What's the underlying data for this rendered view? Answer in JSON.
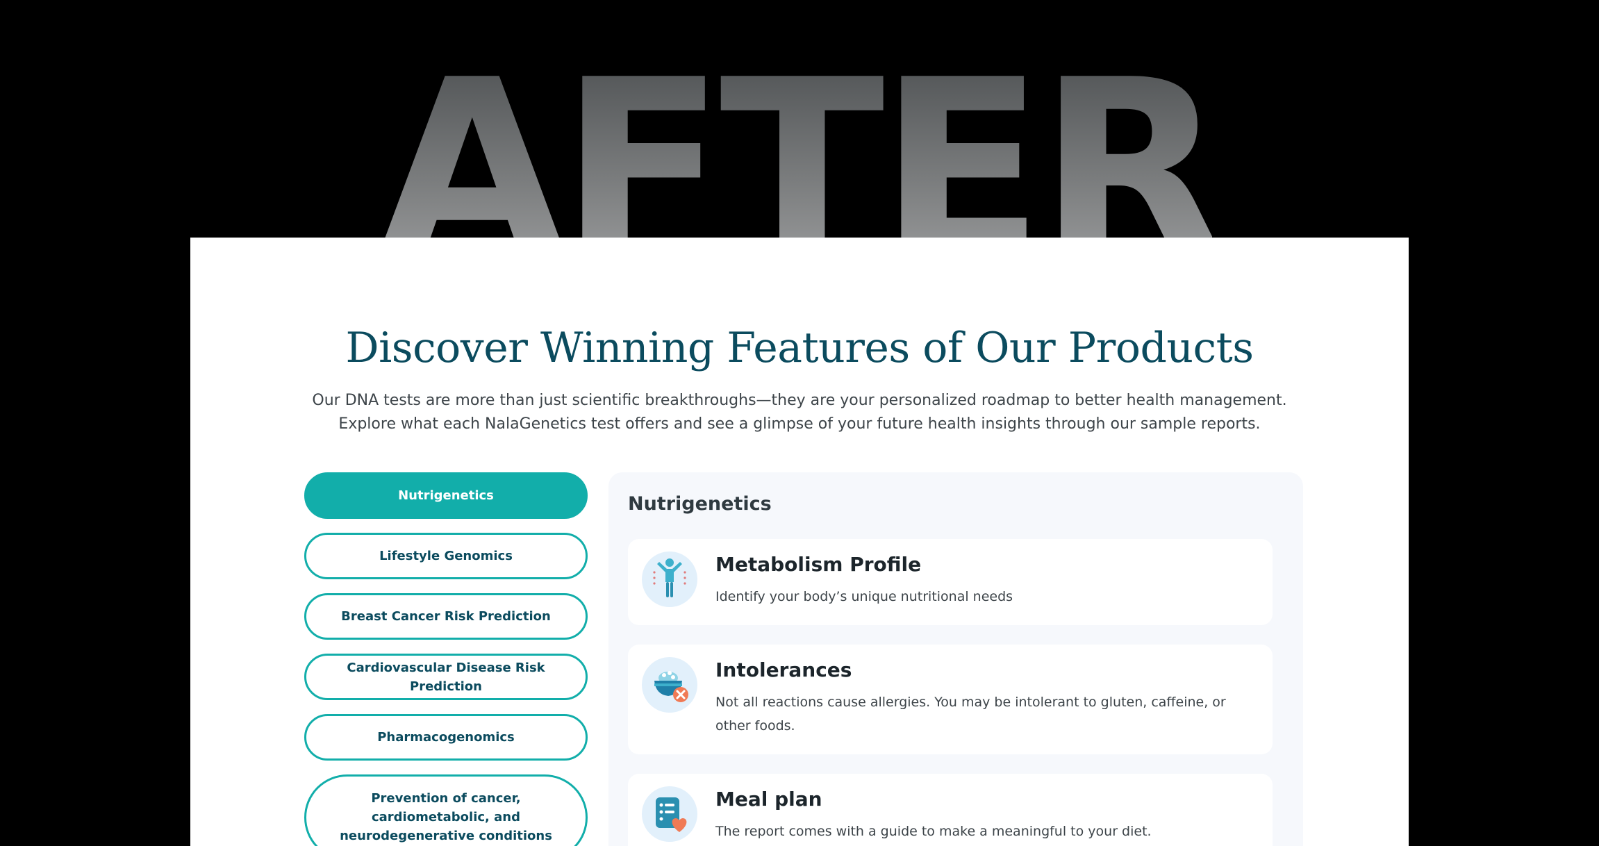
{
  "hero": {
    "word": "AFTER"
  },
  "section": {
    "title": "Discover Winning Features of Our Products",
    "subtitle": "Our DNA tests are more than just scientific breakthroughs—they are your personalized roadmap to better health management. Explore what each NalaGenetics test offers and see a glimpse of your future health insights through our sample reports."
  },
  "tabs": [
    {
      "label": "Nutrigenetics",
      "active": true
    },
    {
      "label": "Lifestyle Genomics",
      "active": false
    },
    {
      "label": "Breast Cancer Risk Prediction",
      "active": false
    },
    {
      "label": "Cardiovascular Disease Risk Prediction",
      "active": false
    },
    {
      "label": "Pharmacogenomics",
      "active": false
    },
    {
      "label": "Prevention of cancer, cardiometabolic, and neurodegenerative conditions",
      "active": false
    }
  ],
  "content": {
    "title": "Nutrigenetics",
    "features": [
      {
        "icon": "person-metabolism-icon",
        "title": "Metabolism Profile",
        "description": "Identify your body’s unique nutritional needs"
      },
      {
        "icon": "food-bowl-intolerance-icon",
        "title": "Intolerances",
        "description": "Not all reactions cause allergies. You may be intolerant to gluten, caffeine, or other foods."
      },
      {
        "icon": "meal-plan-icon",
        "title": "Meal plan",
        "description": "The report comes with a guide to make a meaningful to your diet."
      }
    ]
  },
  "colors": {
    "accent": "#12aeaa",
    "heading": "#0b4b5e",
    "content_background": "#f6f8fc",
    "page_background": "#000000"
  }
}
